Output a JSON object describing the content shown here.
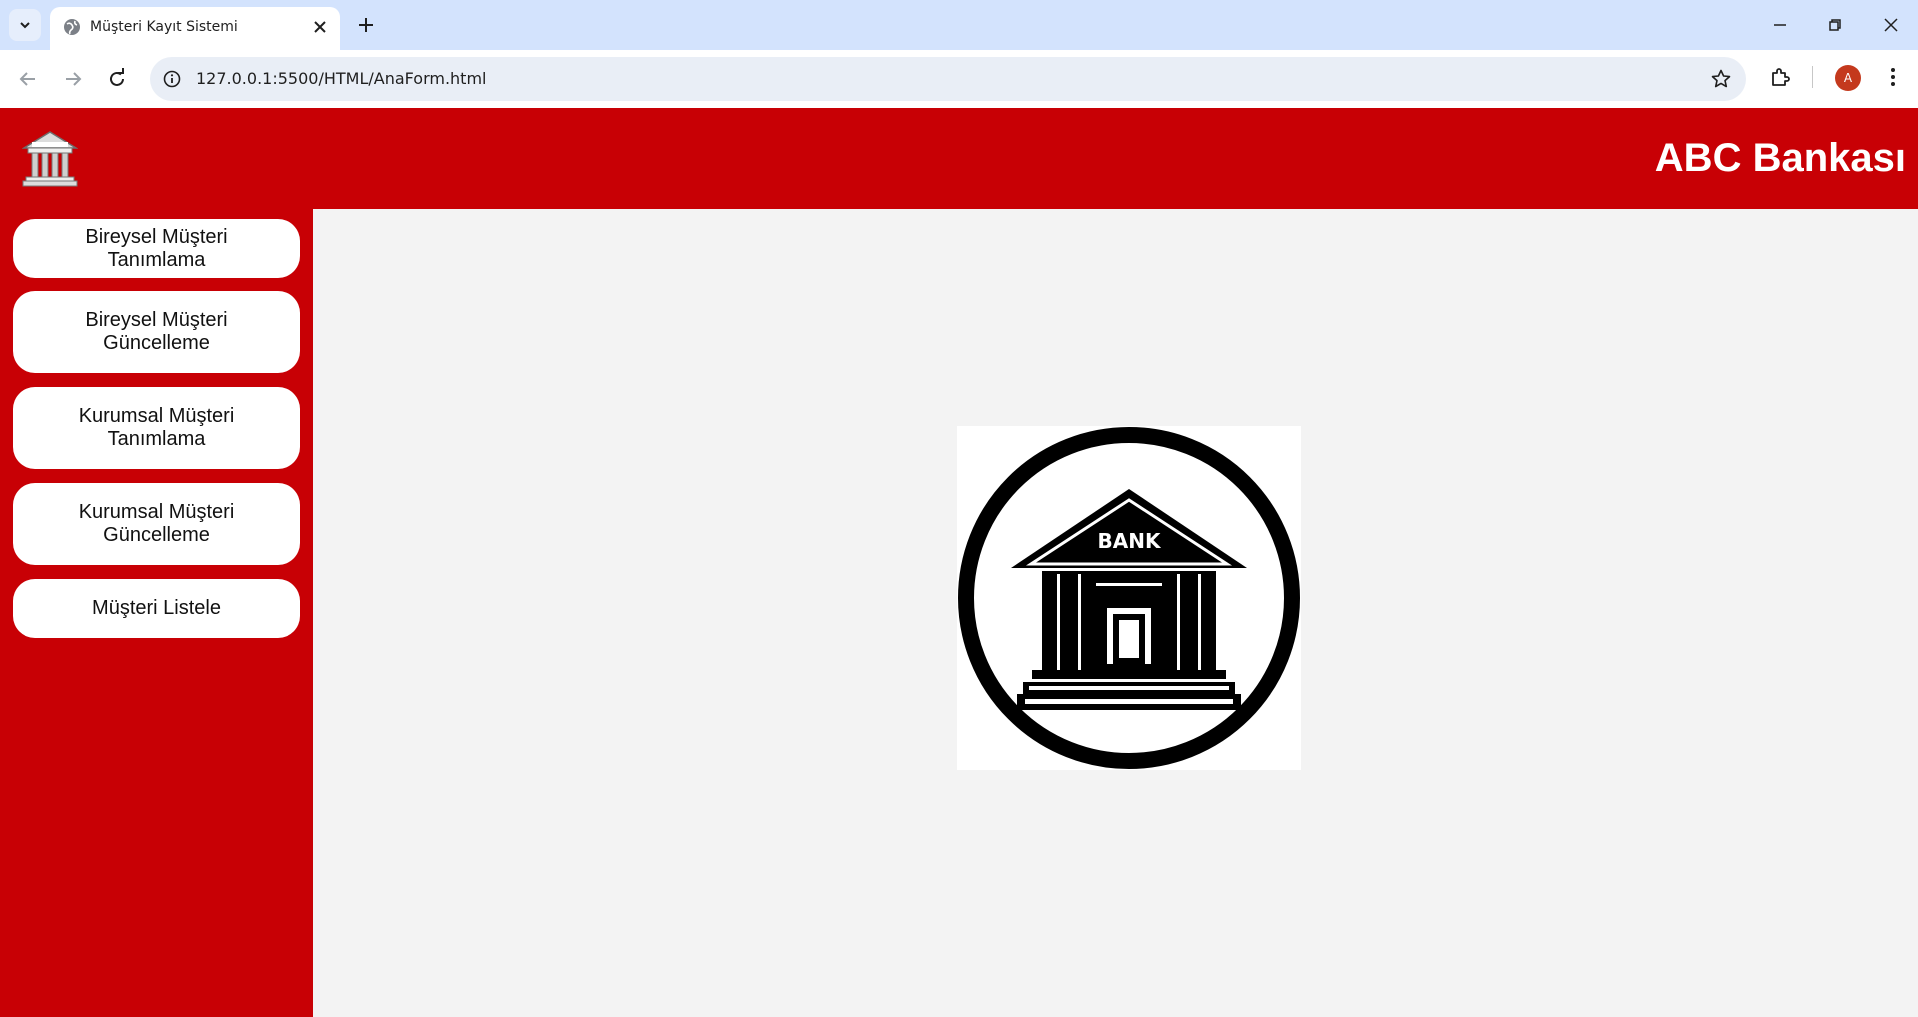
{
  "browser": {
    "tab_title": "Müşteri Kayıt Sistemi",
    "url": "127.0.0.1:5500/HTML/AnaForm.html",
    "profile_initial": "A",
    "profile_color": "#c4391d"
  },
  "header": {
    "brand_title": "ABC Bankası",
    "background_color": "#c80005",
    "logo_icon": "bank-building-icon"
  },
  "sidebar": {
    "items": [
      {
        "label": "Bireysel Müşteri Tanımlama"
      },
      {
        "label": "Bireysel Müşteri Güncelleme"
      },
      {
        "label": "Kurumsal Müşteri Tanımlama"
      },
      {
        "label": "Kurumsal Müşteri Güncelleme"
      },
      {
        "label": "Müşteri Listele"
      }
    ]
  },
  "main": {
    "image_label": "BANK",
    "image_icon": "bank-circle-icon"
  }
}
